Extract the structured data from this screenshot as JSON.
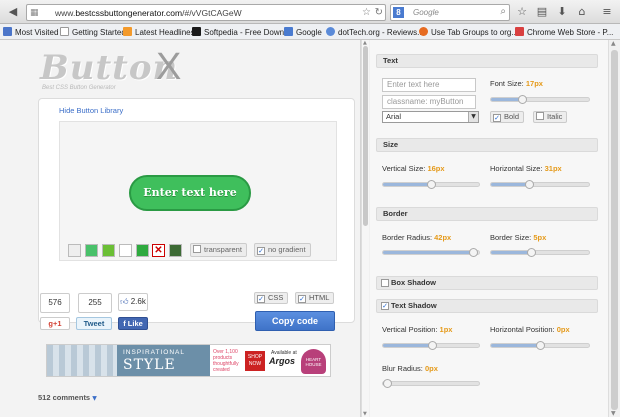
{
  "browser": {
    "url_prefix": "www.",
    "url_host": "bestcssbuttongenerator.com",
    "url_hash": "/#/vVGtCAGeW",
    "search_placeholder": "Google",
    "search_engine_badge": "8",
    "bookmarks": [
      {
        "label": "Most Visited",
        "icon": "star-folder-icon",
        "color": "#4b75c9"
      },
      {
        "label": "Getting Started",
        "icon": "page-icon",
        "color": "#ffffff"
      },
      {
        "label": "Latest Headlines",
        "icon": "rss-icon",
        "color": "#f39a2b"
      },
      {
        "label": "Softpedia - Free Downl...",
        "icon": "softpedia-icon",
        "color": "#1a1a1a"
      },
      {
        "label": "Google",
        "icon": "google-icon",
        "color": "#4a7bd0"
      },
      {
        "label": "dotTech.org - Reviews...",
        "icon": "globe-icon",
        "color": "#5a8ad8"
      },
      {
        "label": "Use Tab Groups to org...",
        "icon": "firefox-icon",
        "color": "#e66b21"
      },
      {
        "label": "Chrome Web Store - P...",
        "icon": "store-icon",
        "color": "#d94040"
      }
    ]
  },
  "logo": {
    "word": "Button",
    "x": "X",
    "tagline": "Best CSS Button Generator"
  },
  "card": {
    "hide_link": "Hide Button Library",
    "demo_button_text": "Enter text here",
    "swatch_colors": [
      "#eeeeee",
      "#49c16a",
      "#6bbf35",
      "#ffffff",
      "#2eaa3f",
      "#ffffff",
      "#3d6b35"
    ],
    "transparent_label": "transparent",
    "no_gradient_label": "no gradient",
    "transparent_checked": false,
    "no_gradient_checked": true
  },
  "social": {
    "count_1": "576",
    "count_2": "255",
    "gplus_label": "g+1",
    "tweet_label": "Tweet",
    "like_label": "Like",
    "like_count": "2.6k"
  },
  "code": {
    "css_label": "CSS",
    "html_label": "HTML",
    "copy_label": "Copy code"
  },
  "ad": {
    "line1": "INSPIRATIONAL",
    "line2": "STYLE",
    "over_text": "Over 1,100 products thoughtfully created",
    "shop_now": "SHOP NOW",
    "available": "Available at",
    "argos": "Argos",
    "heart": "HEART HOUSE"
  },
  "comments": {
    "label": "512 comments",
    "arrow": "▼"
  },
  "settings": {
    "text": {
      "header": "Text",
      "text_placeholder": "Enter text here",
      "classname_placeholder": "classname: myButton",
      "font_family": "Arial",
      "font_size_label": "Font Size:",
      "font_size_value": "17px",
      "font_size_level": 0.3,
      "bold_label": "Bold",
      "italic_label": "Italic",
      "bold_checked": true,
      "italic_checked": false
    },
    "size": {
      "header": "Size",
      "vertical_label": "Vertical Size:",
      "vertical_value": "16px",
      "vertical_level": 0.5,
      "horizontal_label": "Horizontal Size:",
      "horizontal_value": "31px",
      "horizontal_level": 0.38
    },
    "border": {
      "header": "Border",
      "radius_label": "Border Radius:",
      "radius_value": "42px",
      "radius_level": 0.99,
      "size_label": "Border Size:",
      "size_value": "5px",
      "size_level": 0.4
    },
    "box_shadow": {
      "header": "Box Shadow",
      "checked": false
    },
    "text_shadow": {
      "header": "Text Shadow",
      "checked": true,
      "vertical_label": "Vertical Position:",
      "vertical_value": "1px",
      "vertical_level": 0.52,
      "horizontal_label": "Horizontal Position:",
      "horizontal_value": "0px",
      "horizontal_level": 0.5,
      "blur_label": "Blur Radius:",
      "blur_value": "0px",
      "blur_level": 0.0
    }
  },
  "colors": {
    "accent": "#e59a1a",
    "button_green": "#3fbf5c",
    "copy_blue": "#4a80d4"
  }
}
